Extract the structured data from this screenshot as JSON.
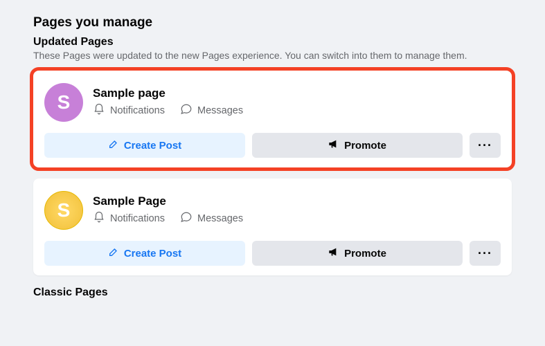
{
  "section": {
    "title": "Pages you manage",
    "updated_title": "Updated Pages",
    "updated_description": "These Pages were updated to the new Pages experience. You can switch into them to manage them.",
    "classic_title": "Classic Pages"
  },
  "pages": [
    {
      "name": "Sample page",
      "avatar_letter": "S",
      "notifications_label": "Notifications",
      "messages_label": "Messages",
      "create_post_label": "Create Post",
      "promote_label": "Promote",
      "more_label": "···"
    },
    {
      "name": "Sample Page",
      "avatar_letter": "S",
      "notifications_label": "Notifications",
      "messages_label": "Messages",
      "create_post_label": "Create Post",
      "promote_label": "Promote",
      "more_label": "···"
    }
  ]
}
